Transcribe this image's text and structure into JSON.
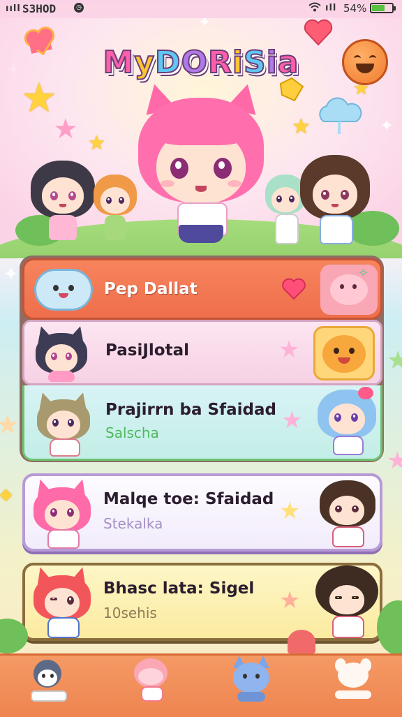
{
  "status_bar": {
    "signal": "ııll",
    "time": "S3HOD",
    "wifi_icon": "wifi-icon",
    "cell_signal": "ıll",
    "battery_percent": "54%",
    "battery_level": 0.6
  },
  "header": {
    "title": "MyDORiSia"
  },
  "menu": {
    "items": [
      {
        "label": "Pep Dallat",
        "sub": ""
      },
      {
        "label": "PasiJlotal",
        "sub": ""
      },
      {
        "label": "Prajirrn ba Sfaidad",
        "sub": "Salscha"
      },
      {
        "label": "Malqe toe: Sfaidad",
        "sub": "Stekalka"
      },
      {
        "label": "Bhasc lata: Sigel",
        "sub": "10sehis"
      }
    ]
  },
  "colors": {
    "accent_orange": "#f07a55",
    "accent_green": "#6cc46e",
    "accent_purple": "#b79ad6",
    "accent_yellow": "#f1d25a",
    "nav_bg": "#f08f5a"
  },
  "bottom_nav": {
    "items": [
      {
        "icon": "shark-character-icon"
      },
      {
        "icon": "pink-creature-icon"
      },
      {
        "icon": "blue-cat-icon"
      },
      {
        "icon": "white-bunny-icon"
      }
    ]
  }
}
